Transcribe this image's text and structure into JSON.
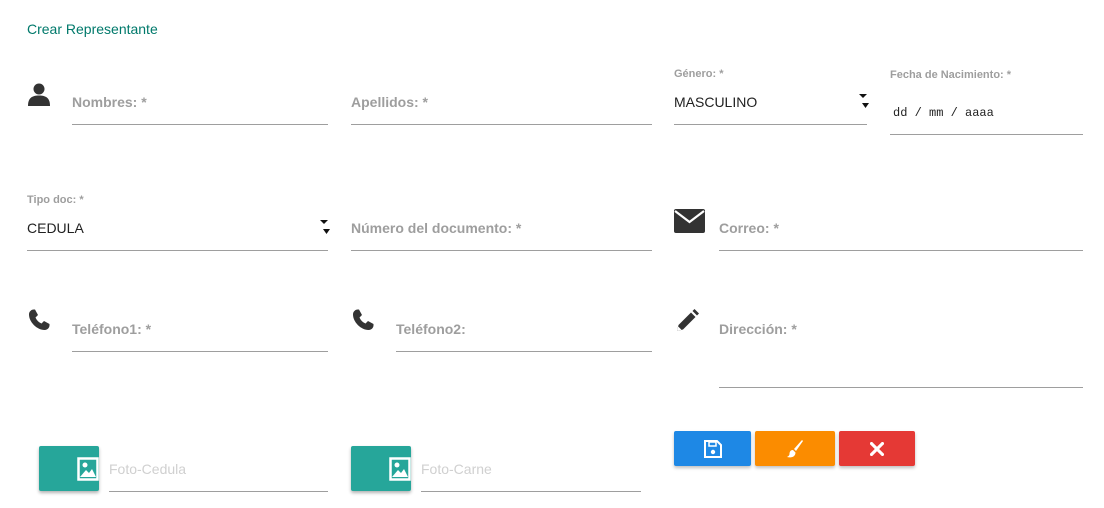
{
  "form": {
    "title": "Crear Representante"
  },
  "fields": {
    "nombres": {
      "label": "Nombres: *"
    },
    "apellidos": {
      "label": "Apellidos: *"
    },
    "genero": {
      "label": "Género: *",
      "value": "MASCULINO"
    },
    "fecha_nacimiento": {
      "label": "Fecha de Nacimiento: *",
      "value": "dd / mm / aaaa"
    },
    "tipo_doc": {
      "label": "Tipo doc: *",
      "value": "CEDULA"
    },
    "numero_documento": {
      "label": "Número del documento: *"
    },
    "correo": {
      "label": "Correo: *"
    },
    "telefono1": {
      "label": "Teléfono1: *"
    },
    "telefono2": {
      "label": "Teléfono2:"
    },
    "direccion": {
      "label": "Dirección: *"
    },
    "foto_cedula": {
      "placeholder": "Foto-Cedula"
    },
    "foto_carne": {
      "placeholder": "Foto-Carne"
    }
  },
  "icons": {
    "user": "user-icon",
    "envelope": "envelope-icon",
    "phone": "phone-icon",
    "pencil": "pencil-icon",
    "image": "image-icon",
    "save": "save-icon",
    "brush": "paint-brush-icon",
    "close": "close-icon"
  },
  "colors": {
    "title": "#00796b",
    "file_button": "#26a69a",
    "save_button": "#1e88e5",
    "clear_button": "#fb8c00",
    "cancel_button": "#e53935",
    "placeholder": "#9e9e9e",
    "underline": "#9e9e9e"
  }
}
